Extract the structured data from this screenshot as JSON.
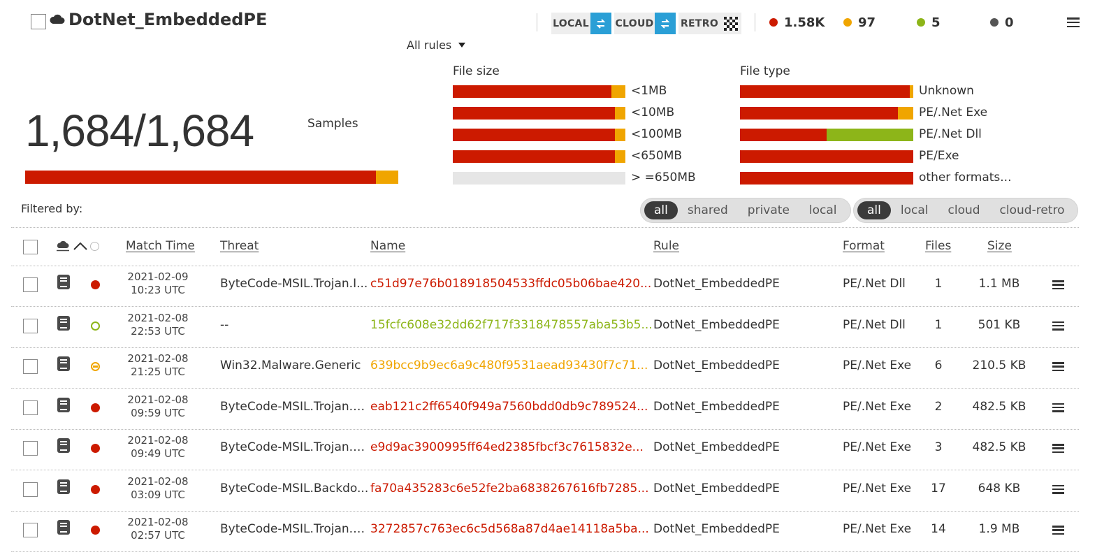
{
  "header": {
    "title": "DotNet_EmbeddedPE",
    "modes": {
      "local": "LOCAL",
      "cloud": "CLOUD",
      "retro": "RETRO"
    },
    "stats": [
      {
        "value": "1.58K",
        "color": "#cc1a00"
      },
      {
        "value": "97",
        "color": "#f0a500"
      },
      {
        "value": "5",
        "color": "#8db519"
      },
      {
        "value": "0",
        "color": "#555555"
      }
    ]
  },
  "rules_dropdown": "All rules",
  "summary": {
    "count": "1,684/1,684",
    "label": "Samples",
    "bar": {
      "red": 0.94,
      "orange": 0.06
    }
  },
  "file_size": {
    "title": "File size",
    "rows": [
      {
        "label": "<1MB",
        "red": 0.92,
        "orange": 0.08
      },
      {
        "label": "<10MB",
        "red": 0.94,
        "orange": 0.06
      },
      {
        "label": "<100MB",
        "red": 0.94,
        "orange": 0.06
      },
      {
        "label": "<650MB",
        "red": 0.94,
        "orange": 0.06
      },
      {
        "label": "> =650MB",
        "red": 0,
        "orange": 0
      }
    ]
  },
  "file_type": {
    "title": "File type",
    "rows": [
      {
        "label": "Unknown",
        "red": 0.98,
        "orange": 0.02,
        "green": 0
      },
      {
        "label": "PE/.Net Exe",
        "red": 0.91,
        "orange": 0.09,
        "green": 0
      },
      {
        "label": "PE/.Net Dll",
        "red": 0.5,
        "orange": 0,
        "green": 0.5
      },
      {
        "label": "PE/Exe",
        "red": 1,
        "orange": 0,
        "green": 0
      },
      {
        "label": "other formats...",
        "red": 1,
        "orange": 0,
        "green": 0
      }
    ]
  },
  "filters": {
    "label": "Filtered by:",
    "sharing": [
      "all",
      "shared",
      "private",
      "local"
    ],
    "sharing_active": "all",
    "source": [
      "all",
      "local",
      "cloud",
      "cloud-retro"
    ],
    "source_active": "all"
  },
  "table": {
    "headers": {
      "match_time": "Match Time",
      "threat": "Threat",
      "name": "Name",
      "rule": "Rule",
      "format": "Format",
      "files": "Files",
      "size": "Size"
    },
    "rows": [
      {
        "date": "2021-02-09",
        "time": "10:23 UTC",
        "status": "red",
        "threat": "ByteCode-MSIL.Trojan.I...",
        "name": "c51d97e76b018918504533ffdc05b06bae420...",
        "name_color": "#cc1a00",
        "rule": "DotNet_EmbeddedPE",
        "format": "PE/.Net Dll",
        "files": "1",
        "size": "1.1 MB"
      },
      {
        "date": "2021-02-08",
        "time": "22:53 UTC",
        "status": "green",
        "threat": "--",
        "name": "15fcfc608e32dd62f717f3318478557aba53b5...",
        "name_color": "#8db519",
        "rule": "DotNet_EmbeddedPE",
        "format": "PE/.Net Dll",
        "files": "1",
        "size": "501 KB"
      },
      {
        "date": "2021-02-08",
        "time": "21:25 UTC",
        "status": "orange",
        "threat": "Win32.Malware.Generic",
        "name": "639bcc9b9ec6a9c480f9531aead93430f7c71...",
        "name_color": "#f0a500",
        "rule": "DotNet_EmbeddedPE",
        "format": "PE/.Net Exe",
        "files": "6",
        "size": "210.5 KB"
      },
      {
        "date": "2021-02-08",
        "time": "09:59 UTC",
        "status": "red",
        "threat": "ByteCode-MSIL.Trojan.V...",
        "name": "eab121c2ff6540f949a7560bdd0db9c789524...",
        "name_color": "#cc1a00",
        "rule": "DotNet_EmbeddedPE",
        "format": "PE/.Net Exe",
        "files": "2",
        "size": "482.5 KB"
      },
      {
        "date": "2021-02-08",
        "time": "09:49 UTC",
        "status": "red",
        "threat": "ByteCode-MSIL.Trojan.V...",
        "name": "e9d9ac3900995ff64ed2385fbcf3c7615832e...",
        "name_color": "#cc1a00",
        "rule": "DotNet_EmbeddedPE",
        "format": "PE/.Net Exe",
        "files": "3",
        "size": "482.5 KB"
      },
      {
        "date": "2021-02-08",
        "time": "03:09 UTC",
        "status": "red",
        "threat": "ByteCode-MSIL.Backdo...",
        "name": "fa70a435283c6e52fe2ba6838267616fb7285...",
        "name_color": "#cc1a00",
        "rule": "DotNet_EmbeddedPE",
        "format": "PE/.Net Exe",
        "files": "17",
        "size": "648 KB"
      },
      {
        "date": "2021-02-08",
        "time": "02:57 UTC",
        "status": "red",
        "threat": "ByteCode-MSIL.Trojan.V...",
        "name": "3272857c763ec6c5d568a87d4ae14118a5ba...",
        "name_color": "#cc1a00",
        "rule": "DotNet_EmbeddedPE",
        "format": "PE/.Net Exe",
        "files": "14",
        "size": "1.9 MB"
      }
    ]
  }
}
